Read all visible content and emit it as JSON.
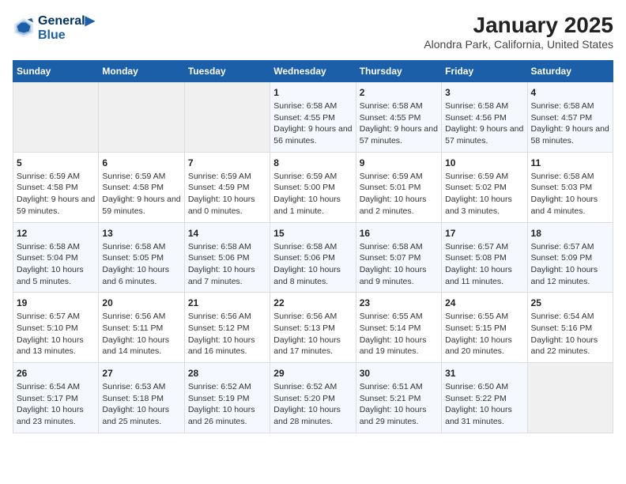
{
  "logo": {
    "line1": "General",
    "line2": "Blue"
  },
  "title": "January 2025",
  "subtitle": "Alondra Park, California, United States",
  "weekdays": [
    "Sunday",
    "Monday",
    "Tuesday",
    "Wednesday",
    "Thursday",
    "Friday",
    "Saturday"
  ],
  "weeks": [
    [
      {
        "day": "",
        "empty": true
      },
      {
        "day": "",
        "empty": true
      },
      {
        "day": "",
        "empty": true
      },
      {
        "day": "1",
        "sunrise": "6:58 AM",
        "sunset": "4:55 PM",
        "daylight": "9 hours and 56 minutes."
      },
      {
        "day": "2",
        "sunrise": "6:58 AM",
        "sunset": "4:55 PM",
        "daylight": "9 hours and 57 minutes."
      },
      {
        "day": "3",
        "sunrise": "6:58 AM",
        "sunset": "4:56 PM",
        "daylight": "9 hours and 57 minutes."
      },
      {
        "day": "4",
        "sunrise": "6:58 AM",
        "sunset": "4:57 PM",
        "daylight": "9 hours and 58 minutes."
      }
    ],
    [
      {
        "day": "5",
        "sunrise": "6:59 AM",
        "sunset": "4:58 PM",
        "daylight": "9 hours and 59 minutes."
      },
      {
        "day": "6",
        "sunrise": "6:59 AM",
        "sunset": "4:58 PM",
        "daylight": "9 hours and 59 minutes."
      },
      {
        "day": "7",
        "sunrise": "6:59 AM",
        "sunset": "4:59 PM",
        "daylight": "10 hours and 0 minutes."
      },
      {
        "day": "8",
        "sunrise": "6:59 AM",
        "sunset": "5:00 PM",
        "daylight": "10 hours and 1 minute."
      },
      {
        "day": "9",
        "sunrise": "6:59 AM",
        "sunset": "5:01 PM",
        "daylight": "10 hours and 2 minutes."
      },
      {
        "day": "10",
        "sunrise": "6:59 AM",
        "sunset": "5:02 PM",
        "daylight": "10 hours and 3 minutes."
      },
      {
        "day": "11",
        "sunrise": "6:58 AM",
        "sunset": "5:03 PM",
        "daylight": "10 hours and 4 minutes."
      }
    ],
    [
      {
        "day": "12",
        "sunrise": "6:58 AM",
        "sunset": "5:04 PM",
        "daylight": "10 hours and 5 minutes."
      },
      {
        "day": "13",
        "sunrise": "6:58 AM",
        "sunset": "5:05 PM",
        "daylight": "10 hours and 6 minutes."
      },
      {
        "day": "14",
        "sunrise": "6:58 AM",
        "sunset": "5:06 PM",
        "daylight": "10 hours and 7 minutes."
      },
      {
        "day": "15",
        "sunrise": "6:58 AM",
        "sunset": "5:06 PM",
        "daylight": "10 hours and 8 minutes."
      },
      {
        "day": "16",
        "sunrise": "6:58 AM",
        "sunset": "5:07 PM",
        "daylight": "10 hours and 9 minutes."
      },
      {
        "day": "17",
        "sunrise": "6:57 AM",
        "sunset": "5:08 PM",
        "daylight": "10 hours and 11 minutes."
      },
      {
        "day": "18",
        "sunrise": "6:57 AM",
        "sunset": "5:09 PM",
        "daylight": "10 hours and 12 minutes."
      }
    ],
    [
      {
        "day": "19",
        "sunrise": "6:57 AM",
        "sunset": "5:10 PM",
        "daylight": "10 hours and 13 minutes."
      },
      {
        "day": "20",
        "sunrise": "6:56 AM",
        "sunset": "5:11 PM",
        "daylight": "10 hours and 14 minutes."
      },
      {
        "day": "21",
        "sunrise": "6:56 AM",
        "sunset": "5:12 PM",
        "daylight": "10 hours and 16 minutes."
      },
      {
        "day": "22",
        "sunrise": "6:56 AM",
        "sunset": "5:13 PM",
        "daylight": "10 hours and 17 minutes."
      },
      {
        "day": "23",
        "sunrise": "6:55 AM",
        "sunset": "5:14 PM",
        "daylight": "10 hours and 19 minutes."
      },
      {
        "day": "24",
        "sunrise": "6:55 AM",
        "sunset": "5:15 PM",
        "daylight": "10 hours and 20 minutes."
      },
      {
        "day": "25",
        "sunrise": "6:54 AM",
        "sunset": "5:16 PM",
        "daylight": "10 hours and 22 minutes."
      }
    ],
    [
      {
        "day": "26",
        "sunrise": "6:54 AM",
        "sunset": "5:17 PM",
        "daylight": "10 hours and 23 minutes."
      },
      {
        "day": "27",
        "sunrise": "6:53 AM",
        "sunset": "5:18 PM",
        "daylight": "10 hours and 25 minutes."
      },
      {
        "day": "28",
        "sunrise": "6:52 AM",
        "sunset": "5:19 PM",
        "daylight": "10 hours and 26 minutes."
      },
      {
        "day": "29",
        "sunrise": "6:52 AM",
        "sunset": "5:20 PM",
        "daylight": "10 hours and 28 minutes."
      },
      {
        "day": "30",
        "sunrise": "6:51 AM",
        "sunset": "5:21 PM",
        "daylight": "10 hours and 29 minutes."
      },
      {
        "day": "31",
        "sunrise": "6:50 AM",
        "sunset": "5:22 PM",
        "daylight": "10 hours and 31 minutes."
      },
      {
        "day": "",
        "empty": true
      }
    ]
  ],
  "labels": {
    "sunrise": "Sunrise:",
    "sunset": "Sunset:",
    "daylight": "Daylight:"
  }
}
